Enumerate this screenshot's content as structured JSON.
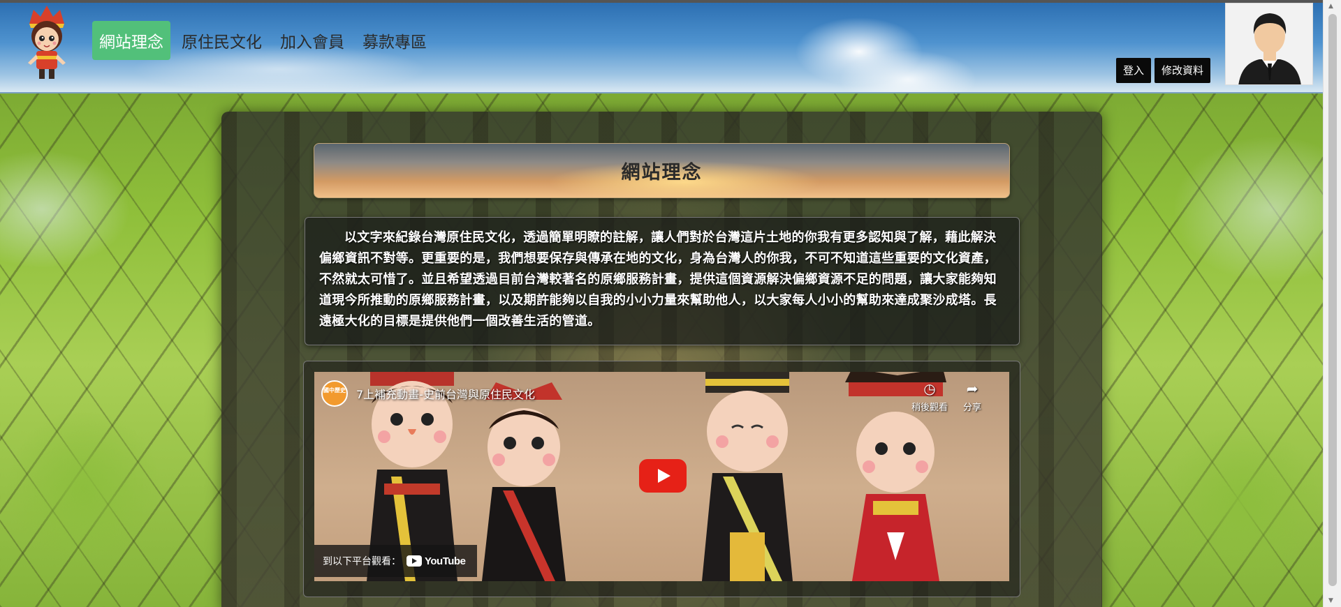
{
  "header": {
    "nav": [
      {
        "label": "網站理念",
        "active": true
      },
      {
        "label": "原住民文化",
        "active": false
      },
      {
        "label": "加入會員",
        "active": false
      },
      {
        "label": "募款專區",
        "active": false
      }
    ],
    "login_label": "登入",
    "edit_profile_label": "修改資料"
  },
  "main": {
    "title": "網站理念",
    "intro": "以文字來紀錄台灣原住民文化，透過簡單明瞭的註解，讓人們對於台灣這片土地的你我有更多認知與了解，藉此解決偏鄉資訊不對等。更重要的是，我們想要保存與傳承在地的文化，身為台灣人的你我，不可不知道這些重要的文化資產，不然就太可惜了。並且希望透過目前台灣較著名的原鄉服務計畫，提供這個資源解決偏鄉資源不足的問題，讓大家能夠知道現今所推動的原鄉服務計畫，以及期許能夠以自我的小小力量來幫助他人，以大家每人小小的幫助來達成聚沙成塔。長遠極大化的目標是提供他們一個改善生活的管道。"
  },
  "video": {
    "channel_badge": "國中歷史",
    "title": "7上補充動畫-史前台灣與原住民文化",
    "watch_later_label": "稍後觀看",
    "share_label": "分享",
    "watch_on_label": "到以下平台觀看：",
    "youtube_label": "YouTube"
  },
  "colors": {
    "nav_active_bg": "#52c07a",
    "auth_button_bg": "#0a0a0a",
    "play_button": "#e62117"
  },
  "icons": {
    "watch_later": "clock-icon",
    "share": "share-arrow-icon",
    "play": "play-icon"
  }
}
